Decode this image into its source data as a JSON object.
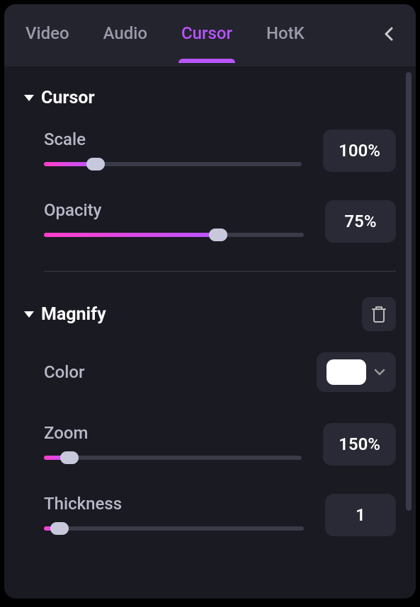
{
  "tabs": {
    "video": "Video",
    "audio": "Audio",
    "cursor": "Cursor",
    "hotkeys": "HotK"
  },
  "sections": {
    "cursor": {
      "title": "Cursor",
      "scale": {
        "label": "Scale",
        "value": "100%",
        "fillPercent": 20
      },
      "opacity": {
        "label": "Opacity",
        "value": "75%",
        "fillPercent": 67
      }
    },
    "magnify": {
      "title": "Magnify",
      "color": {
        "label": "Color",
        "value": "#ffffff"
      },
      "zoom": {
        "label": "Zoom",
        "value": "150%",
        "fillPercent": 10
      },
      "thickness": {
        "label": "Thickness",
        "value": "1",
        "fillPercent": 6
      }
    }
  }
}
